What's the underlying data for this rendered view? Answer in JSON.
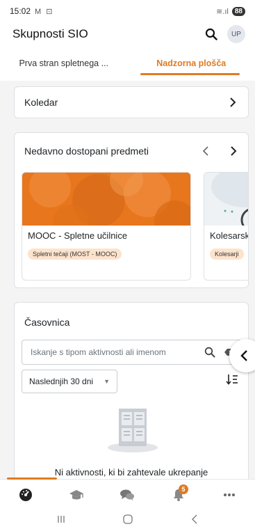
{
  "status_bar": {
    "time": "15:02",
    "notification_icons": "M ⊡",
    "signal": "≋.ıl",
    "battery": "88"
  },
  "app_bar": {
    "title": "Skupnosti SIO",
    "avatar_initials": "UP"
  },
  "tabs": [
    {
      "label": "Prva stran spletnega ...",
      "active": false
    },
    {
      "label": "Nadzorna plošča",
      "active": true
    }
  ],
  "calendar_card": {
    "label": "Koledar"
  },
  "recent_courses": {
    "title": "Nedavno dostopani predmeti",
    "courses": [
      {
        "name": "MOOC - Spletne učilnice",
        "category": "Spletni tečaji (MOST - MOOC)"
      },
      {
        "name": "Kolesarsk",
        "category": "Kolesarji"
      }
    ]
  },
  "timeline": {
    "title": "Časovnica",
    "search_placeholder": "Iskanje s tipom aktivnosti ali imenom",
    "filter_value": "Naslednjih 30 dni",
    "empty_message": "Ni aktivnosti, ki bi zahtevale ukrepanje"
  },
  "bottom_nav": {
    "notification_count": "5"
  },
  "colors": {
    "accent": "#e07b22",
    "course_image": "#e8761d"
  }
}
